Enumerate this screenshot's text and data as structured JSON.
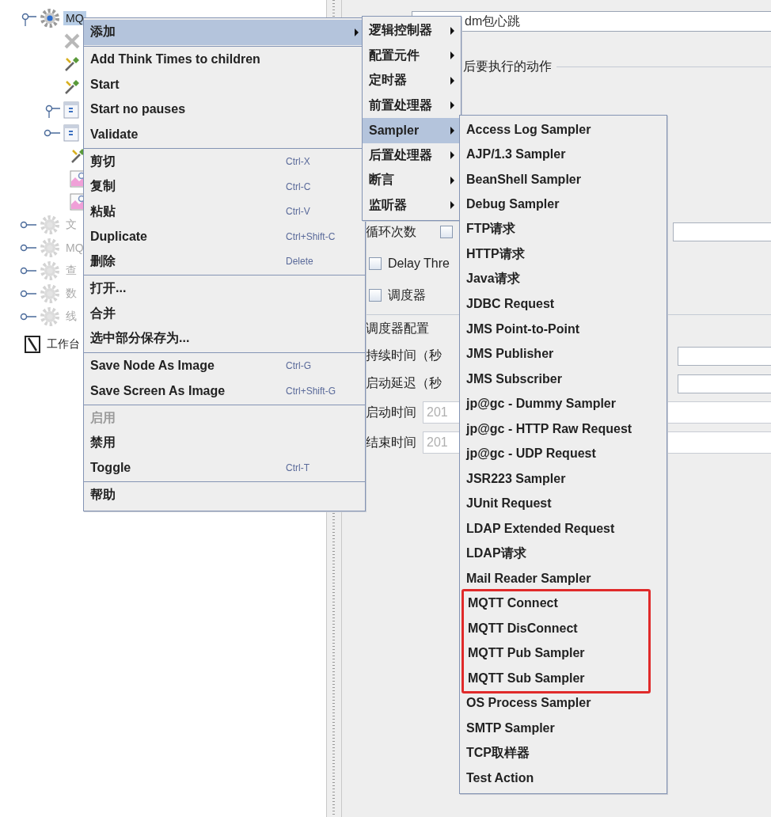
{
  "tree": {
    "items": [
      {
        "kind": "gear",
        "label": "MQ",
        "selected": true,
        "disabled": false,
        "expanded": true,
        "children": [
          {
            "kind": "clear"
          },
          {
            "kind": "tool"
          },
          {
            "kind": "tool"
          },
          {
            "kind": "controller",
            "expanded": true
          },
          {
            "kind": "controller",
            "expanded": false,
            "children": [
              {
                "kind": "tool"
              },
              {
                "kind": "graph"
              },
              {
                "kind": "graph"
              }
            ]
          }
        ]
      },
      {
        "kind": "gear",
        "label": "文",
        "selected": false,
        "disabled": true,
        "expanded": false
      },
      {
        "kind": "gear",
        "label": "MQ",
        "selected": false,
        "disabled": true,
        "expanded": false
      },
      {
        "kind": "gear",
        "label": "查",
        "selected": false,
        "disabled": true,
        "expanded": false
      },
      {
        "kind": "gear",
        "label": "数",
        "selected": false,
        "disabled": true,
        "expanded": false
      },
      {
        "kind": "gear",
        "label": "线",
        "selected": false,
        "disabled": true,
        "expanded": false
      },
      {
        "kind": "workbench",
        "label": "工作台",
        "selected": false
      }
    ]
  },
  "panel": {
    "name_field": {
      "value": "dm包心跳"
    },
    "section_title": "后要执行的动作",
    "rows": [
      {
        "kind": "label-checkbox",
        "label": "循环次数",
        "checked": false
      },
      {
        "kind": "checkbox",
        "label": "Delay Thre",
        "checked": false
      },
      {
        "kind": "checkbox",
        "label": "调度器",
        "checked": false
      },
      {
        "kind": "section",
        "label": "调度器配置"
      },
      {
        "kind": "label-field",
        "label": "持续时间（秒"
      },
      {
        "kind": "label-field",
        "label": "启动延迟（秒"
      },
      {
        "kind": "label-value",
        "label": "启动时间",
        "value": "201",
        "disabled": true
      },
      {
        "kind": "label-value",
        "label": "结束时间",
        "value": "201",
        "disabled": true
      }
    ]
  },
  "context_menu": {
    "items": [
      {
        "kind": "item",
        "label": "添加",
        "submenu": true,
        "selected": true,
        "disabled": false
      },
      {
        "kind": "separator"
      },
      {
        "kind": "item",
        "label": "Add Think Times to children",
        "selected": false,
        "disabled": false
      },
      {
        "kind": "item",
        "label": "Start",
        "selected": false,
        "disabled": false
      },
      {
        "kind": "item",
        "label": "Start no pauses",
        "selected": false,
        "disabled": false
      },
      {
        "kind": "item",
        "label": "Validate",
        "selected": false,
        "disabled": false
      },
      {
        "kind": "separator"
      },
      {
        "kind": "item",
        "label": "剪切",
        "shortcut": "Ctrl-X",
        "selected": false,
        "disabled": false
      },
      {
        "kind": "item",
        "label": "复制",
        "shortcut": "Ctrl-C",
        "selected": false,
        "disabled": false
      },
      {
        "kind": "item",
        "label": "粘贴",
        "shortcut": "Ctrl-V",
        "selected": false,
        "disabled": false
      },
      {
        "kind": "item",
        "label": "Duplicate",
        "shortcut": "Ctrl+Shift-C",
        "selected": false,
        "disabled": false
      },
      {
        "kind": "item",
        "label": "删除",
        "shortcut": "Delete",
        "selected": false,
        "disabled": false
      },
      {
        "kind": "separator"
      },
      {
        "kind": "item",
        "label": "打开...",
        "selected": false,
        "disabled": false
      },
      {
        "kind": "item",
        "label": "合并",
        "selected": false,
        "disabled": false
      },
      {
        "kind": "item",
        "label": "选中部分保存为...",
        "selected": false,
        "disabled": false
      },
      {
        "kind": "separator"
      },
      {
        "kind": "item",
        "label": "Save Node As Image",
        "shortcut": "Ctrl-G",
        "selected": false,
        "disabled": false
      },
      {
        "kind": "item",
        "label": "Save Screen As Image",
        "shortcut": "Ctrl+Shift-G",
        "selected": false,
        "disabled": false
      },
      {
        "kind": "separator"
      },
      {
        "kind": "item",
        "label": "启用",
        "selected": false,
        "disabled": true
      },
      {
        "kind": "item",
        "label": "禁用",
        "selected": false,
        "disabled": false
      },
      {
        "kind": "item",
        "label": "Toggle",
        "shortcut": "Ctrl-T",
        "selected": false,
        "disabled": false
      },
      {
        "kind": "separator"
      },
      {
        "kind": "item",
        "label": "帮助",
        "selected": false,
        "disabled": false
      }
    ]
  },
  "add_submenu": {
    "items": [
      {
        "kind": "item",
        "label": "逻辑控制器",
        "submenu": true,
        "selected": false
      },
      {
        "kind": "item",
        "label": "配置元件",
        "submenu": true,
        "selected": false
      },
      {
        "kind": "item",
        "label": "定时器",
        "submenu": true,
        "selected": false
      },
      {
        "kind": "item",
        "label": "前置处理器",
        "submenu": true,
        "selected": false
      },
      {
        "kind": "item",
        "label": "Sampler",
        "submenu": true,
        "selected": true
      },
      {
        "kind": "item",
        "label": "后置处理器",
        "submenu": true,
        "selected": false
      },
      {
        "kind": "item",
        "label": "断言",
        "submenu": true,
        "selected": false
      },
      {
        "kind": "item",
        "label": "监听器",
        "submenu": true,
        "selected": false
      }
    ]
  },
  "sampler_submenu": {
    "items": [
      {
        "kind": "item",
        "label": "Access Log Sampler",
        "selected": false
      },
      {
        "kind": "item",
        "label": "AJP/1.3 Sampler",
        "selected": false
      },
      {
        "kind": "item",
        "label": "BeanShell Sampler",
        "selected": false
      },
      {
        "kind": "item",
        "label": "Debug Sampler",
        "selected": false
      },
      {
        "kind": "item",
        "label": "FTP请求",
        "selected": false
      },
      {
        "kind": "item",
        "label": "HTTP请求",
        "selected": false
      },
      {
        "kind": "item",
        "label": "Java请求",
        "selected": false
      },
      {
        "kind": "item",
        "label": "JDBC Request",
        "selected": false
      },
      {
        "kind": "item",
        "label": "JMS Point-to-Point",
        "selected": false
      },
      {
        "kind": "item",
        "label": "JMS Publisher",
        "selected": false
      },
      {
        "kind": "item",
        "label": "JMS Subscriber",
        "selected": false
      },
      {
        "kind": "item",
        "label": "jp@gc - Dummy Sampler",
        "selected": false
      },
      {
        "kind": "item",
        "label": "jp@gc - HTTP Raw Request",
        "selected": false
      },
      {
        "kind": "item",
        "label": "jp@gc - UDP Request",
        "selected": false
      },
      {
        "kind": "item",
        "label": "JSR223 Sampler",
        "selected": false
      },
      {
        "kind": "item",
        "label": "JUnit Request",
        "selected": false
      },
      {
        "kind": "item",
        "label": "LDAP Extended Request",
        "selected": false
      },
      {
        "kind": "item",
        "label": "LDAP请求",
        "selected": false
      },
      {
        "kind": "item",
        "label": "Mail Reader Sampler",
        "selected": false
      },
      {
        "kind": "highlight-group",
        "color": "#e02a2a",
        "items": [
          {
            "kind": "item",
            "label": "MQTT Connect",
            "selected": false
          },
          {
            "kind": "item",
            "label": "MQTT DisConnect",
            "selected": false
          },
          {
            "kind": "item",
            "label": "MQTT Pub Sampler",
            "selected": false
          },
          {
            "kind": "item",
            "label": "MQTT Sub Sampler",
            "selected": false
          }
        ]
      },
      {
        "kind": "item",
        "label": "OS Process Sampler",
        "selected": false
      },
      {
        "kind": "item",
        "label": "SMTP Sampler",
        "selected": false
      },
      {
        "kind": "item",
        "label": "TCP取样器",
        "selected": false
      },
      {
        "kind": "item",
        "label": "Test Action",
        "selected": false
      }
    ]
  }
}
